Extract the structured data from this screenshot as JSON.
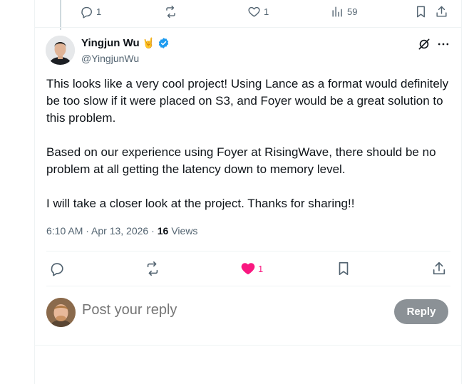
{
  "previous_tweet": {
    "replies": "1",
    "reposts": "",
    "likes": "1",
    "views": "59"
  },
  "tweet": {
    "author_name": "Yingjun Wu",
    "author_emoji": "🤘",
    "handle": "@YingjunWu",
    "paragraphs": [
      "This looks like a very cool project! Using Lance as a format would definitely be too slow if it were placed on S3, and Foyer would be a great solution to this problem.",
      "Based on our experience using Foyer at RisingWave, there should be no problem at all getting the latency down to memory level.",
      "I will take a closer look at the project. Thanks for sharing!!"
    ],
    "timestamp": "6:10 AM · Apr 13, 2026 ·",
    "views_count": "16",
    "views_label": "Views",
    "likes": "1"
  },
  "reply": {
    "placeholder": "Post your reply",
    "button_label": "Reply"
  },
  "colors": {
    "accent": "#1d9bf0",
    "like": "#f91880",
    "muted": "#536471",
    "reply_button": "#8b9196"
  }
}
